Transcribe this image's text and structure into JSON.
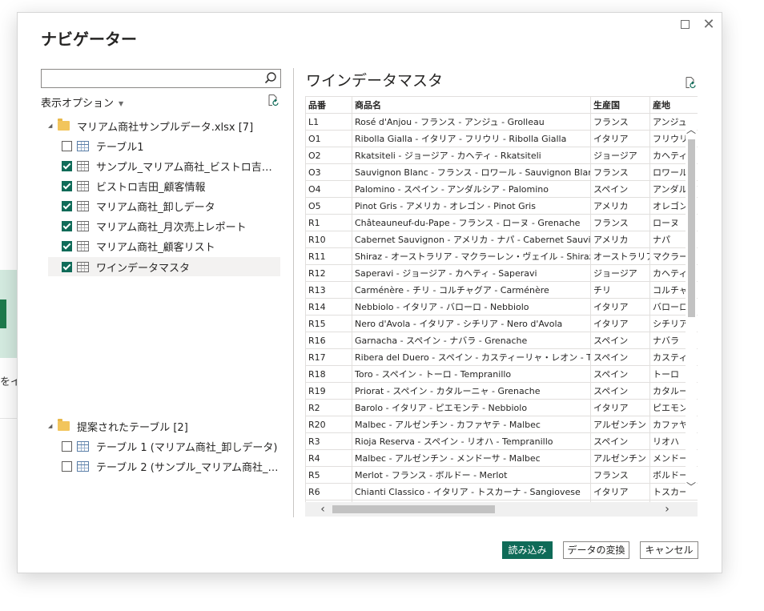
{
  "background": {
    "partial_text": "をイ"
  },
  "dialog": {
    "title": "ナビゲーター",
    "maximize_icon": "maximize-icon",
    "close_icon": "close-icon",
    "close_glyph": "✕"
  },
  "left_pane": {
    "search": {
      "value": "",
      "placeholder": ""
    },
    "display_options_label": "表示オプション",
    "file_node": {
      "label": "マリアム商社サンプルデータ.xlsx [7]",
      "expanded": true,
      "items": [
        {
          "label": "テーブル1",
          "checked": false,
          "icon": "table-icon"
        },
        {
          "label": "サンプル_マリアム商社_ビストロ吉田受...",
          "checked": true,
          "icon": "sheet-icon"
        },
        {
          "label": "ビストロ吉田_顧客情報",
          "checked": true,
          "icon": "sheet-icon"
        },
        {
          "label": "マリアム商社_卸しデータ",
          "checked": true,
          "icon": "sheet-icon"
        },
        {
          "label": "マリアム商社_月次売上レポート",
          "checked": true,
          "icon": "sheet-icon"
        },
        {
          "label": "マリアム商社_顧客リスト",
          "checked": true,
          "icon": "sheet-icon"
        },
        {
          "label": "ワインデータマスタ",
          "checked": true,
          "icon": "sheet-icon",
          "selected": true
        }
      ]
    },
    "suggested_node": {
      "label": "提案されたテーブル [2]",
      "expanded": true,
      "items": [
        {
          "label": "テーブル 1 (マリアム商社_卸しデータ)",
          "checked": false,
          "icon": "table-icon"
        },
        {
          "label": "テーブル 2 (サンプル_マリアム商社_ビス...",
          "checked": false,
          "icon": "table-icon"
        }
      ]
    }
  },
  "preview": {
    "title": "ワインデータマスタ",
    "columns": [
      "品番",
      "商品名",
      "生産国",
      "産地"
    ],
    "rows": [
      [
        "L1",
        "Rosé d'Anjou - フランス - アンジュ - Grolleau",
        "フランス",
        "アンジュ"
      ],
      [
        "O1",
        "Ribolla Gialla - イタリア - フリウリ - Ribolla Gialla",
        "イタリア",
        "フリウリ"
      ],
      [
        "O2",
        "Rkatsiteli - ジョージア - カヘティ - Rkatsiteli",
        "ジョージア",
        "カヘティ"
      ],
      [
        "O3",
        "Sauvignon Blanc - フランス - ロワール - Sauvignon Blanc",
        "フランス",
        "ロワール"
      ],
      [
        "O4",
        "Palomino - スペイン - アンダルシア - Palomino",
        "スペイン",
        "アンダルシア"
      ],
      [
        "O5",
        "Pinot Gris - アメリカ - オレゴン - Pinot Gris",
        "アメリカ",
        "オレゴン"
      ],
      [
        "R1",
        "Châteauneuf-du-Pape - フランス - ローヌ - Grenache",
        "フランス",
        "ローヌ"
      ],
      [
        "R10",
        "Cabernet Sauvignon - アメリカ - ナパ - Cabernet Sauvignon",
        "アメリカ",
        "ナパ"
      ],
      [
        "R11",
        "Shiraz - オーストラリア - マクラーレン・ヴェイル - Shiraz",
        "オーストラリア",
        "マクラーレン・ヴェイル"
      ],
      [
        "R12",
        "Saperavi - ジョージア - カヘティ - Saperavi",
        "ジョージア",
        "カヘティ"
      ],
      [
        "R13",
        "Carménère - チリ - コルチャグア - Carménère",
        "チリ",
        "コルチャグア"
      ],
      [
        "R14",
        "Nebbiolo - イタリア - バローロ - Nebbiolo",
        "イタリア",
        "バローロ"
      ],
      [
        "R15",
        "Nero d'Avola - イタリア - シチリア - Nero d'Avola",
        "イタリア",
        "シチリア"
      ],
      [
        "R16",
        "Garnacha - スペイン - ナバラ - Grenache",
        "スペイン",
        "ナバラ"
      ],
      [
        "R17",
        "Ribera del Duero - スペイン - カスティーリャ・レオン - Tempranillo",
        "スペイン",
        "カスティーリャ・レオン"
      ],
      [
        "R18",
        "Toro - スペイン - トーロ - Tempranillo",
        "スペイン",
        "トーロ"
      ],
      [
        "R19",
        "Priorat - スペイン - カタルーニャ - Grenache",
        "スペイン",
        "カタルーニャ"
      ],
      [
        "R2",
        "Barolo - イタリア - ピエモンテ - Nebbiolo",
        "イタリア",
        "ピエモンテ"
      ],
      [
        "R20",
        "Malbec - アルゼンチン - カファヤテ - Malbec",
        "アルゼンチン",
        "カファヤテ"
      ],
      [
        "R3",
        "Rioja Reserva - スペイン - リオハ - Tempranillo",
        "スペイン",
        "リオハ"
      ],
      [
        "R4",
        "Malbec - アルゼンチン - メンドーサ - Malbec",
        "アルゼンチン",
        "メンドーサ"
      ],
      [
        "R5",
        "Merlot - フランス - ボルドー - Merlot",
        "フランス",
        "ボルドー"
      ],
      [
        "R6",
        "Chianti Classico - イタリア - トスカーナ - Sangiovese",
        "イタリア",
        "トスカーナ"
      ],
      [
        "",
        "",
        "",
        ""
      ]
    ]
  },
  "buttons": {
    "load": "読み込み",
    "transform": "データの変換",
    "cancel": "キャンセル"
  },
  "colors": {
    "accent": "#0f6b58",
    "folder": "#f2c55c"
  }
}
